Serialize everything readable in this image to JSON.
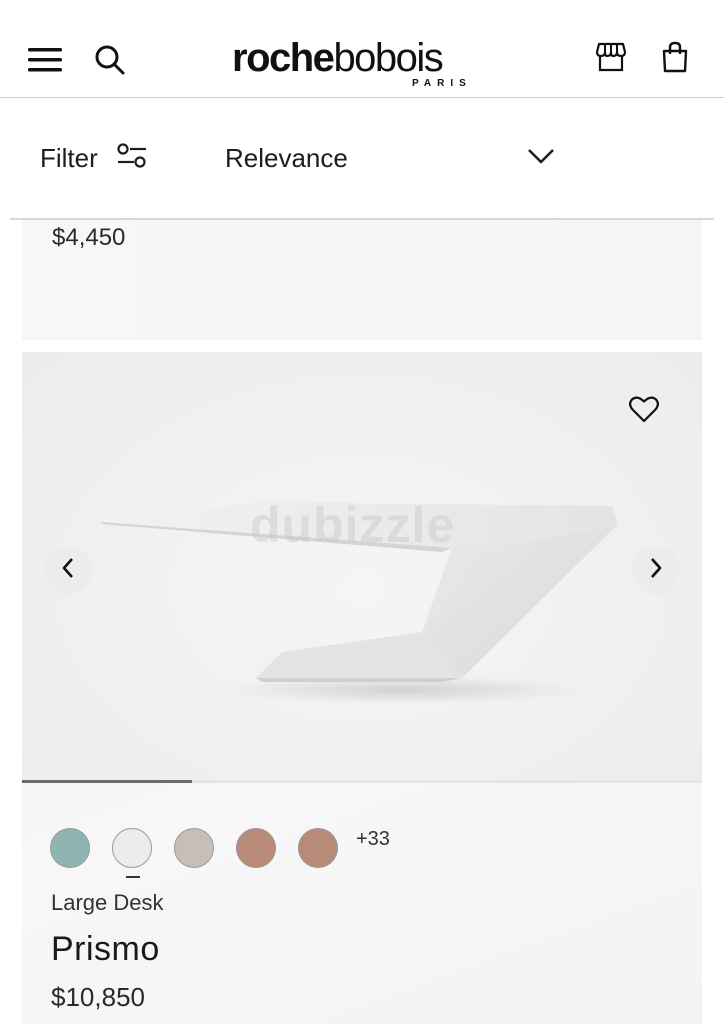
{
  "header": {
    "menu_icon": "hamburger-icon",
    "search_icon": "search-icon",
    "logo_bold": "roche",
    "logo_light": "bobois",
    "logo_sub": "PARIS",
    "store_icon": "store-icon",
    "bag_icon": "shopping-bag-icon"
  },
  "toolbar": {
    "filter_label": "Filter",
    "filter_icon": "filter-sliders-icon",
    "sort_label": "Relevance",
    "sort_icon": "chevron-down-icon"
  },
  "previous_product": {
    "price": "$4,450"
  },
  "product": {
    "watermark": "dubizzle",
    "carousel_progress": 0.25,
    "swatches": [
      {
        "color": "#8fb5b0"
      },
      {
        "color": "#ececec"
      },
      {
        "color": "#c8beb6"
      },
      {
        "color": "#b88a78"
      },
      {
        "color": "#b88a78"
      }
    ],
    "more_swatches": "+33",
    "category": "Large Desk",
    "name": "Prismo",
    "price": "$10,850"
  }
}
